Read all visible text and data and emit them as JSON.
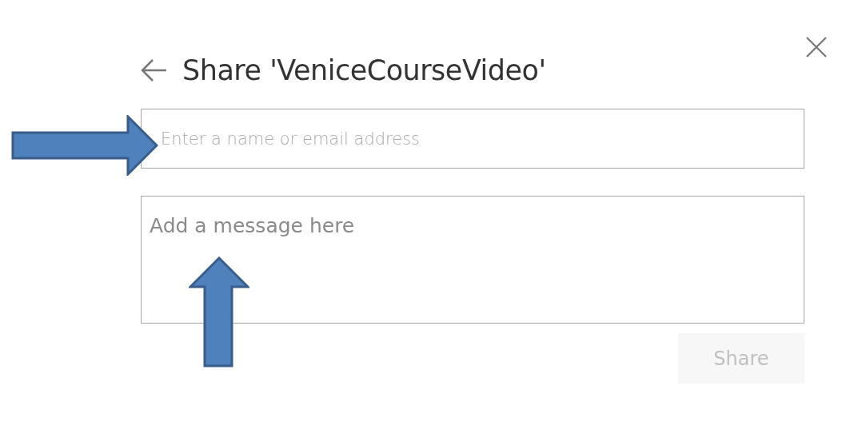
{
  "dialog": {
    "title": "Share 'VeniceCourseVideo'",
    "recipient_field": {
      "placeholder": "Enter a name or email address"
    },
    "message_field": {
      "placeholder": "Add a message here"
    },
    "share_button": {
      "label": "Share",
      "disabled": true
    }
  }
}
